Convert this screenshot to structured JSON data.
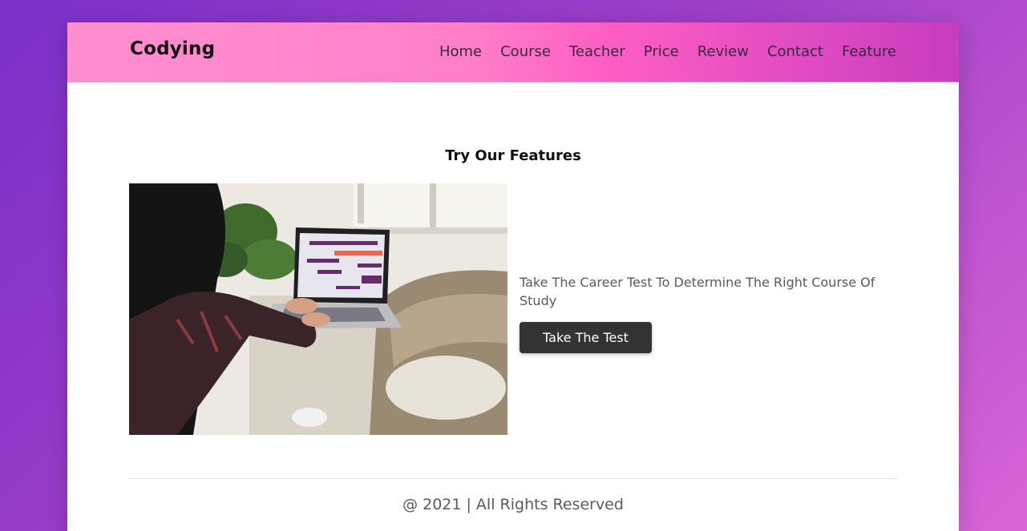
{
  "header": {
    "brand": "Codying",
    "nav": [
      "Home",
      "Course",
      "Teacher",
      "Price",
      "Review",
      "Contact",
      "Feature"
    ]
  },
  "features": {
    "title": "Try Our Features",
    "image_alt": "person using laptop",
    "description": "Take The Career Test To Determine The Right Course Of Study",
    "button_label": "Take The Test"
  },
  "footer": {
    "text": "@ 2021 | All Rights Reserved"
  },
  "colors": {
    "button_bg": "#333333",
    "nav_gradient_start": "#ff8fcf",
    "nav_gradient_end": "#c83cc0",
    "page_bg_start": "#7b2fc9",
    "page_bg_end": "#d765d6"
  }
}
